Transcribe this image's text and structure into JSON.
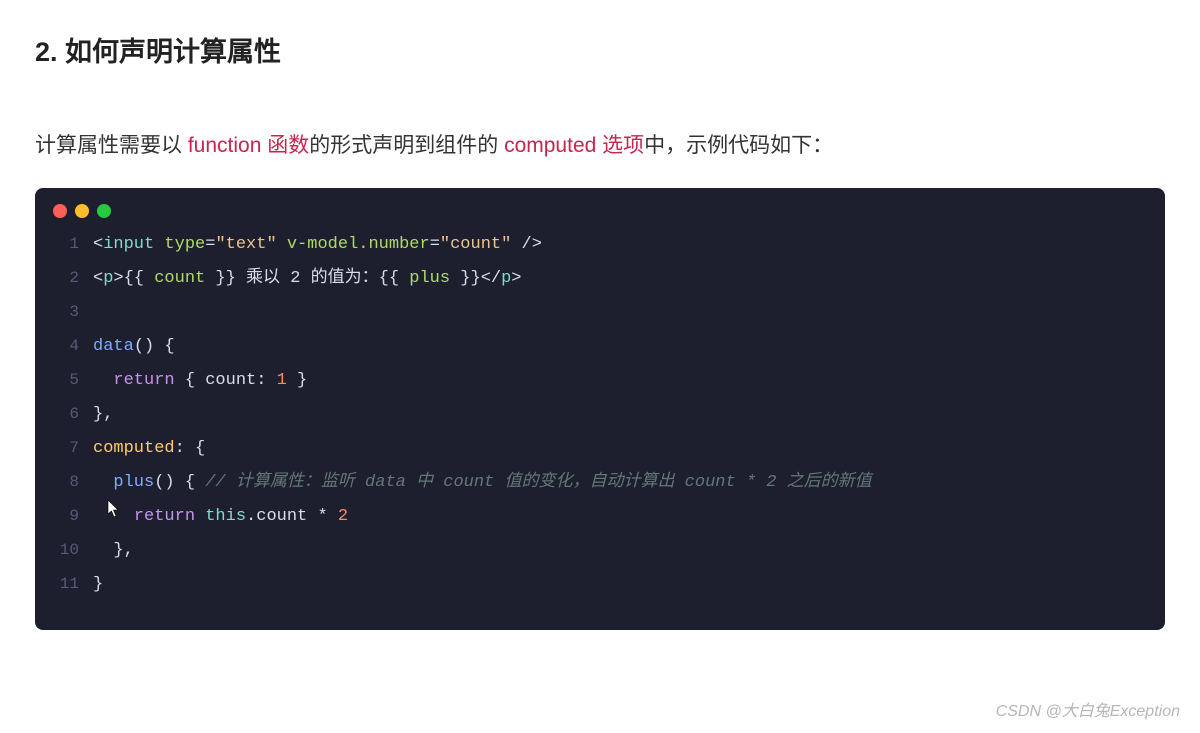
{
  "heading": "2. 如何声明计算属性",
  "intro": {
    "p1": "计算属性需要以 ",
    "kw1": "function 函数",
    "p2": "的形式声明到组件的 ",
    "kw2": "computed 选项",
    "p3": "中，示例代码如下："
  },
  "code": {
    "lines": [
      "1",
      "2",
      "3",
      "4",
      "5",
      "6",
      "7",
      "8",
      "9",
      "10",
      "11"
    ],
    "l1": {
      "a": "<",
      "tag1": "input",
      "sp1": " ",
      "attr1": "type",
      "eq1": "=",
      "str1": "\"text\"",
      "sp2": " ",
      "attr2": "v-model.number",
      "eq2": "=",
      "str2": "\"count\"",
      "sp3": " ",
      "close": "/>"
    },
    "l2": {
      "a": "<",
      "tag": "p",
      "b": ">",
      "t1": "{{ ",
      "id1": "count",
      "t2": " }} 乘以 2 的值为：{{ ",
      "id2": "plus",
      "t3": " }}",
      "c": "</",
      "tag2": "p",
      "d": ">"
    },
    "l4": {
      "fn": "data",
      "rest": "() {"
    },
    "l5": {
      "indent": "  ",
      "ret": "return",
      "rest": " { count: ",
      "num": "1",
      "end": " }"
    },
    "l6": {
      "txt": "},"
    },
    "l7": {
      "prop": "computed",
      "rest": ": {"
    },
    "l8": {
      "indent": "  ",
      "fn": "plus",
      "rest": "() { ",
      "comm": "// 计算属性：监听 data 中 count 值的变化，自动计算出 count * 2 之后的新值"
    },
    "l9": {
      "indent": "    ",
      "ret": "return",
      "sp": " ",
      "this": "this",
      "rest": ".count * ",
      "num": "2"
    },
    "l10": {
      "indent": "  ",
      "txt": "},"
    },
    "l11": {
      "txt": "}"
    }
  },
  "watermark": "CSDN @大白兔Exception"
}
